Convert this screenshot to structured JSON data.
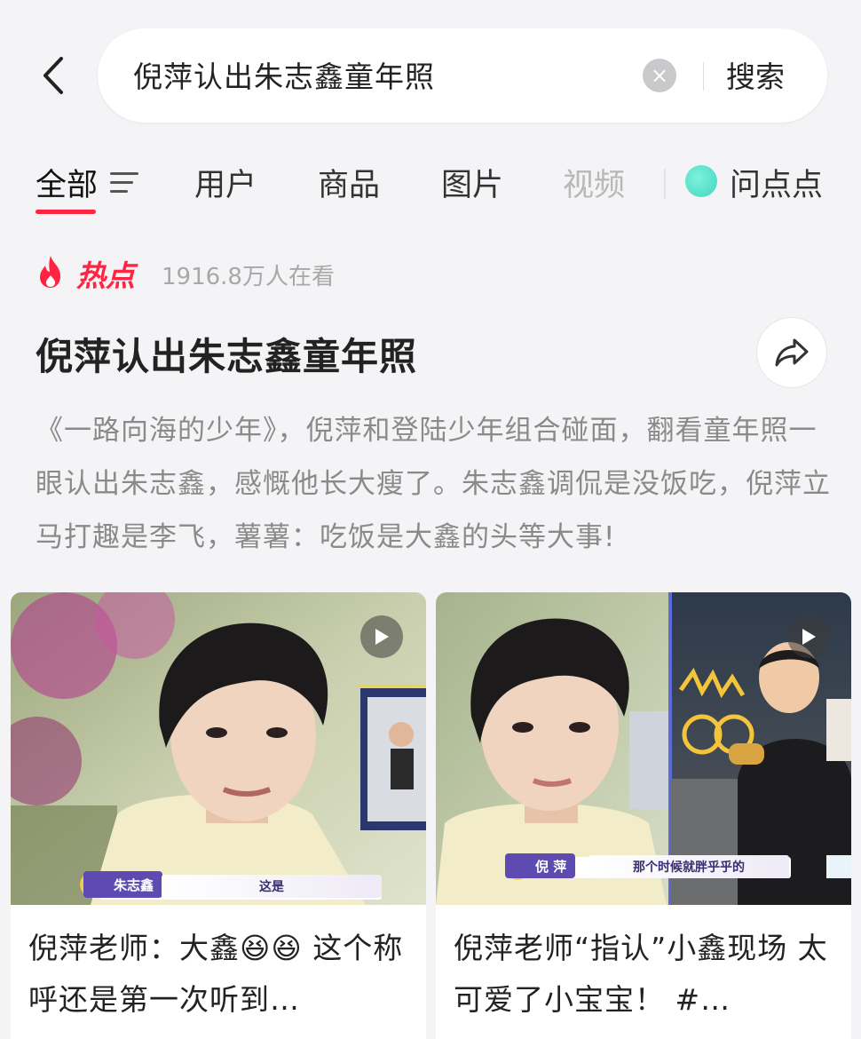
{
  "search": {
    "query": "倪萍认出朱志鑫童年照",
    "clear_symbol": "×",
    "button_label": "搜索"
  },
  "tabs": [
    {
      "label": "全部",
      "active": true
    },
    {
      "label": "用户"
    },
    {
      "label": "商品"
    },
    {
      "label": "图片"
    },
    {
      "label": "视频"
    },
    {
      "label": "问点点"
    }
  ],
  "hot": {
    "label": "热点",
    "viewers": "1916.8万人在看",
    "accent_color": "#ff2442"
  },
  "topic": {
    "title": "倪萍认出朱志鑫童年照",
    "description": "《一路向海的少年》，倪萍和登陆少年组合碰面，翻看童年照一眼认出朱志鑫，感慨他长大瘦了。朱志鑫调侃是没饭吃，倪萍立马打趣是李飞，薯薯：吃饭是大鑫的头等大事!"
  },
  "cards": [
    {
      "title": "倪萍老师：大鑫😆😆 这个称呼还是第一次听到…",
      "caption_name": "朱志鑫",
      "caption_text": "这是",
      "type_icon": "play-icon"
    },
    {
      "title": "倪萍老师“指认”小鑫现场 太可爱了小宝宝！ #…",
      "caption_name": "倪 萍",
      "caption_text": "那个时候就胖乎乎的",
      "type_icon": "play-icon"
    }
  ]
}
